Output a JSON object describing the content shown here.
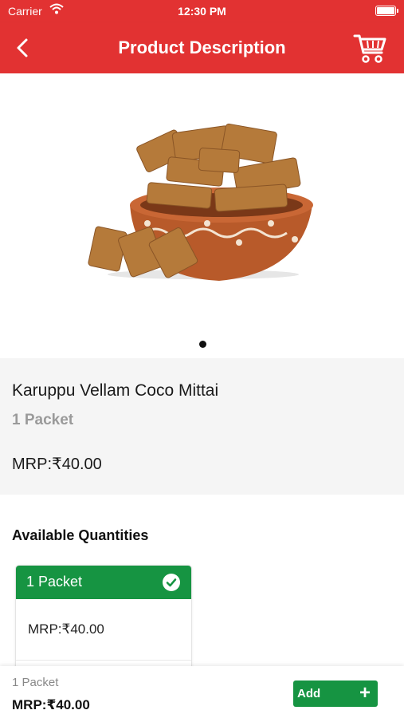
{
  "status_bar": {
    "carrier": "Carrier",
    "time": "12:30 PM"
  },
  "header": {
    "title": "Product Description",
    "back_icon": "chevron-left-icon",
    "cart_icon": "cart-icon"
  },
  "product": {
    "name": "Karuppu Vellam Coco Mittai",
    "unit": "1 Packet",
    "mrp": "MRP:₹40.00",
    "image_page_count": 1,
    "image_current_page": 1
  },
  "quantities": {
    "title": "Available Quantities",
    "options": [
      {
        "label": "1 Packet",
        "mrp": "MRP:₹40.00",
        "selected": true
      }
    ]
  },
  "bottom_bar": {
    "unit": "1 Packet",
    "mrp": "MRP:₹40.00",
    "add_label": "Add",
    "add_icon": "plus"
  },
  "colors": {
    "brand_red": "#e23232",
    "accent_green": "#169442"
  }
}
